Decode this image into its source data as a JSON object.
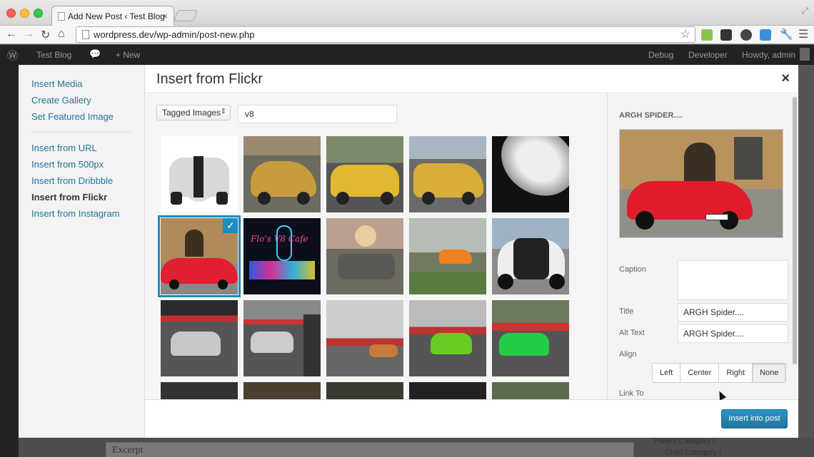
{
  "browser": {
    "tab_title": "Add New Post ‹ Test Blog",
    "url": "wordpress.dev/wp-admin/post-new.php"
  },
  "adminbar": {
    "site_name": "Test Blog",
    "new_label": "+ New",
    "debug_label": "Debug",
    "developer_label": "Developer",
    "howdy_label": "Howdy, admin"
  },
  "menu": {
    "items_top": [
      "Insert Media",
      "Create Gallery",
      "Set Featured Image"
    ],
    "items_bottom": [
      "Insert from URL",
      "Insert from 500px",
      "Insert from Dribbble",
      "Insert from Flickr",
      "Insert from Instagram"
    ],
    "active": "Insert from Flickr"
  },
  "frame": {
    "title": "Insert from Flickr",
    "close_label": "×"
  },
  "toolbar": {
    "filter_selected": "Tagged Images",
    "search_value": "v8"
  },
  "details": {
    "title": "ARGH SPIDER....",
    "caption_label": "Caption",
    "caption_value": "",
    "title_label": "Title",
    "title_value": "ARGH Spider....",
    "alt_label": "Alt Text",
    "alt_value": "ARGH Spider....",
    "align_label": "Align",
    "align_options": [
      "Left",
      "Center",
      "Right",
      "None"
    ],
    "align_selected": "None",
    "link_label": "Link To"
  },
  "footer": {
    "insert_label": "Insert into post"
  },
  "background": {
    "excerpt_label": "Excerpt",
    "parent_category": "Parent Category I",
    "child_category": "Child Category I"
  },
  "colors": {
    "accent": "#1e8cbe",
    "link": "#21759b"
  }
}
